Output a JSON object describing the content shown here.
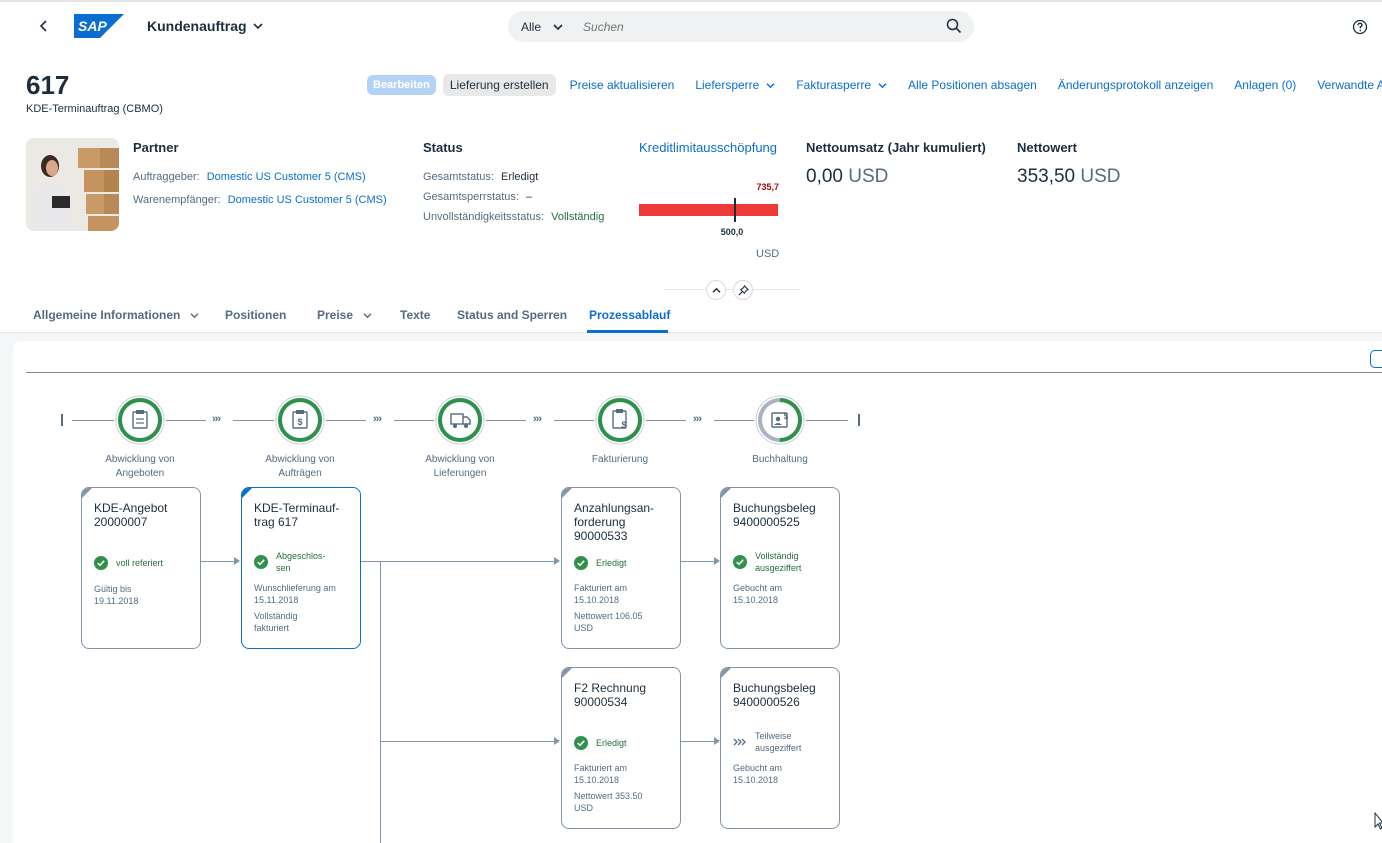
{
  "shell": {
    "title": "Kundenauftrag",
    "search_scope": "Alle",
    "search_placeholder": "Suchen"
  },
  "header": {
    "title": "617",
    "subtitle": "KDE-Terminauftrag (CBMO)",
    "actions": {
      "edit": "Bearbeiten",
      "create_delivery": "Lieferung erstellen",
      "update_prices": "Preise aktualisieren",
      "delivery_block": "Liefersperre",
      "billing_block": "Fakturasperre",
      "reject_items": "Alle Positionen absagen",
      "change_log": "Änderungsprotokoll anzeigen",
      "attachments": "Anlagen (0)",
      "related_apps": "Verwandte Apps"
    },
    "partner": {
      "title": "Partner",
      "sold_to_label": "Auftraggeber:",
      "sold_to_value": "Domestic US Customer 5 (CMS)",
      "ship_to_label": "Warenempfänger:",
      "ship_to_value": "Domestic US Customer 5 (CMS)"
    },
    "status": {
      "title": "Status",
      "overall_label": "Gesamtstatus:",
      "overall_value": "Erledigt",
      "block_label": "Gesamtsperrstatus:",
      "block_value": "–",
      "incompletion_label": "Unvollständigkeitsstatus:",
      "incompletion_value": "Vollständig"
    },
    "credit": {
      "title": "Kreditlimitausschöpfung",
      "actual": "735,7",
      "target": "500,0",
      "unit": "USD",
      "fill_fraction": 1.0,
      "target_fraction": 0.68,
      "bar_color": "#ee3939"
    },
    "net_sales": {
      "title": "Nettoumsatz (Jahr kumuliert)",
      "value": "0,00",
      "unit": "USD"
    },
    "net_value": {
      "title": "Nettowert",
      "value": "353,50",
      "unit": "USD"
    }
  },
  "tabs": [
    {
      "label": "Allgemeine Informationen"
    },
    {
      "label": "Positionen"
    },
    {
      "label": "Preise"
    },
    {
      "label": "Texte"
    },
    {
      "label": "Status and Sperren"
    },
    {
      "label": "Prozessablauf"
    }
  ],
  "active_tab": "Prozessablauf",
  "process_flow": {
    "lanes": [
      {
        "label1": "Abwicklung von",
        "label2": "Angeboten",
        "progress": 1.0
      },
      {
        "label1": "Abwicklung von",
        "label2": "Aufträgen",
        "progress": 1.0
      },
      {
        "label1": "Abwicklung von",
        "label2": "Lieferungen",
        "progress": 1.0
      },
      {
        "label1": "Fakturierung",
        "label2": "",
        "progress": 1.0
      },
      {
        "label1": "Buchhaltung",
        "label2": "",
        "progress": 0.5
      }
    ],
    "nodes": {
      "quotation": {
        "title1": "KDE-Angebot",
        "title2": "20000007",
        "status": "voll referiert",
        "detail1": "Gültig bis",
        "detail2": "19.11.2018"
      },
      "order": {
        "title1": "KDE-Terminauf-",
        "title2": "trag 617",
        "status1": "Abgeschlos-",
        "status2": "sen",
        "detail1": "Wunschlieferung am",
        "detail2": "15.11.2018",
        "detail3": "Vollständig",
        "detail4": "fakturiert"
      },
      "downpayment": {
        "title1": "Anzahlungsan-",
        "title2": "forderung",
        "title3": "90000533",
        "status": "Erledigt",
        "detail1": "Fakturiert am",
        "detail2": "15.10.2018",
        "detail3": "Nettowert 106.05",
        "detail4": "USD"
      },
      "journal1": {
        "title1": "Buchungsbeleg",
        "title2": "9400000525",
        "status1": "Vollständig",
        "status2": "ausgeziffert",
        "detail1": "Gebucht am",
        "detail2": "15.10.2018"
      },
      "invoice": {
        "title1": "F2 Rechnung",
        "title2": "90000534",
        "status": "Erledigt",
        "detail1": "Fakturiert am",
        "detail2": "15.10.2018",
        "detail3": "Nettowert 353.50",
        "detail4": "USD"
      },
      "journal2": {
        "title1": "Buchungsbeleg",
        "title2": "9400000526",
        "status1": "Teilweise",
        "status2": "ausgeziffert",
        "detail1": "Gebucht am",
        "detail2": "15.10.2018"
      }
    }
  },
  "colors": {
    "brand": "#0a6ed1",
    "positive": "#256f3a",
    "lane_progress": "#30914c",
    "neutral": "#8396a8",
    "negative": "#ee3939"
  },
  "icons": {
    "back": "chevron-left-icon",
    "help": "help-icon",
    "search": "search-icon",
    "lanes": [
      "quotation-icon",
      "order-icon",
      "delivery-truck-icon",
      "invoice-icon",
      "accounting-icon"
    ]
  }
}
